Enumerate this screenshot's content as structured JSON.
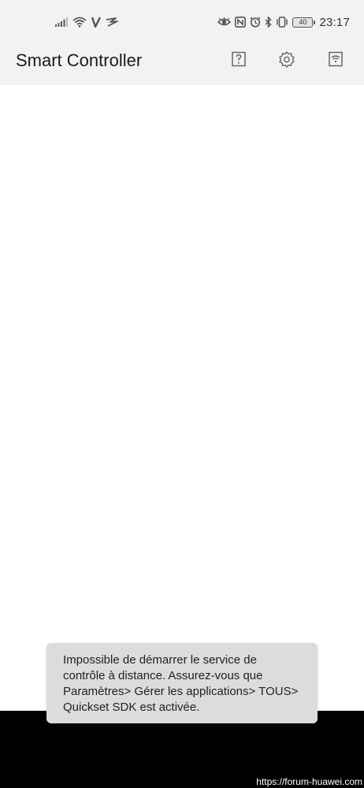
{
  "status_bar": {
    "time": "23:17",
    "battery_level": "40",
    "left_icons": [
      "signal-icon",
      "wifi-icon",
      "v-logo-icon",
      "swiftkey-icon"
    ],
    "right_icons": [
      "eye-comfort-icon",
      "nfc-icon",
      "alarm-icon",
      "bluetooth-icon",
      "vibrate-icon",
      "battery-icon"
    ]
  },
  "app_bar": {
    "title": "Smart Controller",
    "actions": [
      "help-icon",
      "settings-icon",
      "wifi-remote-icon"
    ]
  },
  "toast": {
    "message": "Impossible de démarrer le service de contrôle à distance. Assurez-vous que Paramètres> Gérer les applications> TOUS> Quickset SDK est activée."
  },
  "watermark": {
    "text": "https://forum-huawei.com"
  },
  "colors": {
    "bar_background": "#f2f2f2",
    "toast_background": "#dcdcdc",
    "nav_background": "#000000"
  }
}
